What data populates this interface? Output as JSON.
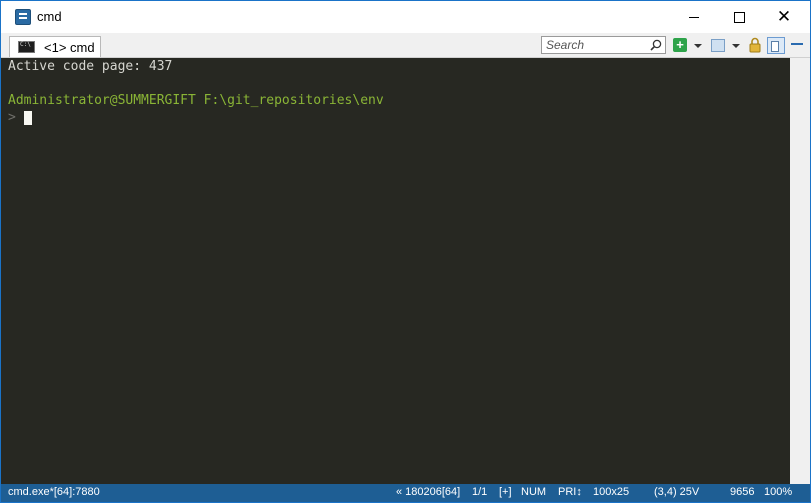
{
  "window": {
    "title": "cmd",
    "accent": "#1a73c8"
  },
  "toolbar": {
    "tab_label": "<1> cmd",
    "search_placeholder": "Search"
  },
  "console": {
    "background": "#272822",
    "lines": [
      "Active code page: 437",
      "Administrator@SUMMERGIFT F:\\git_repositories\\env"
    ],
    "prompt": ">",
    "prompt_color": "#8ab536"
  },
  "statusbar": {
    "process": "cmd.exe*[64]:7880",
    "build": "« 180206[64]",
    "console_index": "1/1",
    "insert_mode": "[+]",
    "num_lock": "NUM",
    "priority": "PRI↕",
    "size": "100x25",
    "cursor": "(3,4) 25V",
    "pid": "9656",
    "zoom": "100%",
    "background": "#1e5e94"
  }
}
